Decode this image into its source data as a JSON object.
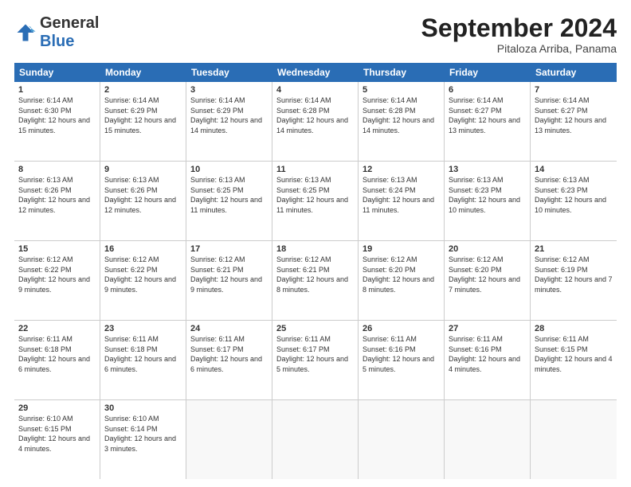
{
  "header": {
    "logo_general": "General",
    "logo_blue": "Blue",
    "month_title": "September 2024",
    "subtitle": "Pitaloza Arriba, Panama"
  },
  "days_of_week": [
    "Sunday",
    "Monday",
    "Tuesday",
    "Wednesday",
    "Thursday",
    "Friday",
    "Saturday"
  ],
  "weeks": [
    [
      {
        "day": "1",
        "sunrise": "6:14 AM",
        "sunset": "6:30 PM",
        "daylight": "12 hours and 15 minutes."
      },
      {
        "day": "2",
        "sunrise": "6:14 AM",
        "sunset": "6:29 PM",
        "daylight": "12 hours and 15 minutes."
      },
      {
        "day": "3",
        "sunrise": "6:14 AM",
        "sunset": "6:29 PM",
        "daylight": "12 hours and 14 minutes."
      },
      {
        "day": "4",
        "sunrise": "6:14 AM",
        "sunset": "6:28 PM",
        "daylight": "12 hours and 14 minutes."
      },
      {
        "day": "5",
        "sunrise": "6:14 AM",
        "sunset": "6:28 PM",
        "daylight": "12 hours and 14 minutes."
      },
      {
        "day": "6",
        "sunrise": "6:14 AM",
        "sunset": "6:27 PM",
        "daylight": "12 hours and 13 minutes."
      },
      {
        "day": "7",
        "sunrise": "6:14 AM",
        "sunset": "6:27 PM",
        "daylight": "12 hours and 13 minutes."
      }
    ],
    [
      {
        "day": "8",
        "sunrise": "6:13 AM",
        "sunset": "6:26 PM",
        "daylight": "12 hours and 12 minutes."
      },
      {
        "day": "9",
        "sunrise": "6:13 AM",
        "sunset": "6:26 PM",
        "daylight": "12 hours and 12 minutes."
      },
      {
        "day": "10",
        "sunrise": "6:13 AM",
        "sunset": "6:25 PM",
        "daylight": "12 hours and 11 minutes."
      },
      {
        "day": "11",
        "sunrise": "6:13 AM",
        "sunset": "6:25 PM",
        "daylight": "12 hours and 11 minutes."
      },
      {
        "day": "12",
        "sunrise": "6:13 AM",
        "sunset": "6:24 PM",
        "daylight": "12 hours and 11 minutes."
      },
      {
        "day": "13",
        "sunrise": "6:13 AM",
        "sunset": "6:23 PM",
        "daylight": "12 hours and 10 minutes."
      },
      {
        "day": "14",
        "sunrise": "6:13 AM",
        "sunset": "6:23 PM",
        "daylight": "12 hours and 10 minutes."
      }
    ],
    [
      {
        "day": "15",
        "sunrise": "6:12 AM",
        "sunset": "6:22 PM",
        "daylight": "12 hours and 9 minutes."
      },
      {
        "day": "16",
        "sunrise": "6:12 AM",
        "sunset": "6:22 PM",
        "daylight": "12 hours and 9 minutes."
      },
      {
        "day": "17",
        "sunrise": "6:12 AM",
        "sunset": "6:21 PM",
        "daylight": "12 hours and 9 minutes."
      },
      {
        "day": "18",
        "sunrise": "6:12 AM",
        "sunset": "6:21 PM",
        "daylight": "12 hours and 8 minutes."
      },
      {
        "day": "19",
        "sunrise": "6:12 AM",
        "sunset": "6:20 PM",
        "daylight": "12 hours and 8 minutes."
      },
      {
        "day": "20",
        "sunrise": "6:12 AM",
        "sunset": "6:20 PM",
        "daylight": "12 hours and 7 minutes."
      },
      {
        "day": "21",
        "sunrise": "6:12 AM",
        "sunset": "6:19 PM",
        "daylight": "12 hours and 7 minutes."
      }
    ],
    [
      {
        "day": "22",
        "sunrise": "6:11 AM",
        "sunset": "6:18 PM",
        "daylight": "12 hours and 6 minutes."
      },
      {
        "day": "23",
        "sunrise": "6:11 AM",
        "sunset": "6:18 PM",
        "daylight": "12 hours and 6 minutes."
      },
      {
        "day": "24",
        "sunrise": "6:11 AM",
        "sunset": "6:17 PM",
        "daylight": "12 hours and 6 minutes."
      },
      {
        "day": "25",
        "sunrise": "6:11 AM",
        "sunset": "6:17 PM",
        "daylight": "12 hours and 5 minutes."
      },
      {
        "day": "26",
        "sunrise": "6:11 AM",
        "sunset": "6:16 PM",
        "daylight": "12 hours and 5 minutes."
      },
      {
        "day": "27",
        "sunrise": "6:11 AM",
        "sunset": "6:16 PM",
        "daylight": "12 hours and 4 minutes."
      },
      {
        "day": "28",
        "sunrise": "6:11 AM",
        "sunset": "6:15 PM",
        "daylight": "12 hours and 4 minutes."
      }
    ],
    [
      {
        "day": "29",
        "sunrise": "6:10 AM",
        "sunset": "6:15 PM",
        "daylight": "12 hours and 4 minutes."
      },
      {
        "day": "30",
        "sunrise": "6:10 AM",
        "sunset": "6:14 PM",
        "daylight": "12 hours and 3 minutes."
      },
      null,
      null,
      null,
      null,
      null
    ]
  ]
}
